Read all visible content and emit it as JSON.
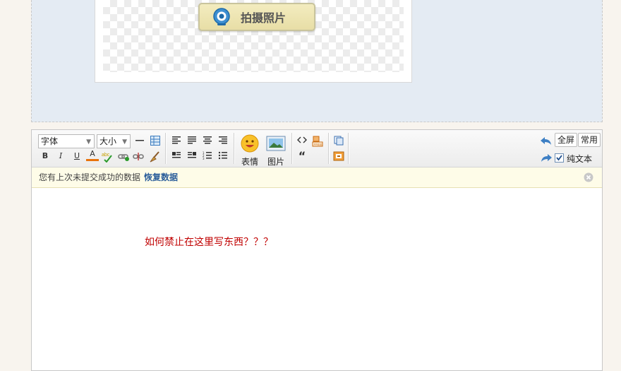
{
  "photo_area": {
    "shoot_button_label": "拍摄照片"
  },
  "toolbar": {
    "font_select": "字体",
    "size_select": "大小",
    "bold": "B",
    "italic": "I",
    "underline": "U",
    "font_color": "A",
    "emoji_label": "表情",
    "image_label": "图片",
    "quote": "“",
    "fullscreen_label": "全屏",
    "common_label": "常用",
    "plaintext_label": "纯文本",
    "plaintext_checked": true
  },
  "notice": {
    "message": "您有上次未提交成功的数据",
    "restore_link": "恢复数据"
  },
  "editor_content": {
    "text": "如何禁止在这里写东西？？？"
  },
  "colors": {
    "accent_link": "#2a5d9a",
    "content_text": "#c00000",
    "notice_bg": "#fefce8"
  }
}
